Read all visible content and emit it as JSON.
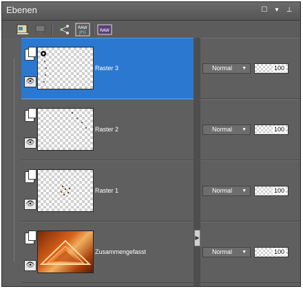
{
  "panel": {
    "title": "Ebenen"
  },
  "toolbar": {
    "icons": [
      "layer-palette-icon",
      "display-icon",
      "link-icon",
      "raw-jpg-icon",
      "raw-icon"
    ]
  },
  "layers": [
    {
      "name": "Raster 3",
      "blend_mode": "Normal",
      "opacity": "100",
      "selected": true
    },
    {
      "name": "Raster 2",
      "blend_mode": "Normal",
      "opacity": "100",
      "selected": false
    },
    {
      "name": "Raster 1",
      "blend_mode": "Normal",
      "opacity": "100",
      "selected": false
    },
    {
      "name": "Zusammengefasst",
      "blend_mode": "Normal",
      "opacity": "100",
      "selected": false
    }
  ],
  "colors": {
    "selection": "#2a78cf",
    "panel": "#5f5f5f"
  }
}
